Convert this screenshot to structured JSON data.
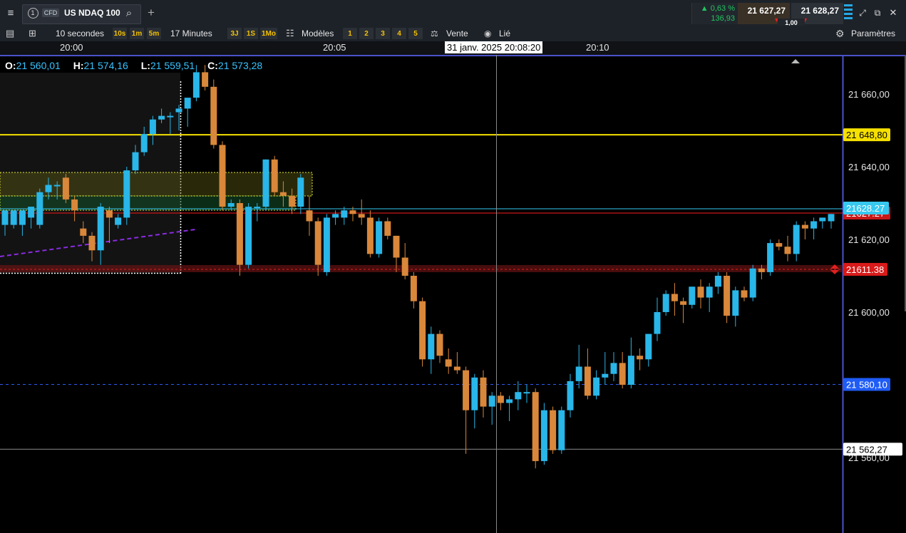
{
  "header": {
    "tab_number": "1",
    "tab_tag": "CFD",
    "instrument": "US NDAQ 100",
    "change_pct": "0,63 %",
    "change_abs": "136,93",
    "sell_price": "21 627,27",
    "buy_price": "21 628,27",
    "spread": "1,00"
  },
  "toolbar": {
    "interval": "10 secondes",
    "quick_intervals": [
      "10s",
      "1m",
      "5m"
    ],
    "range": "17 Minutes",
    "ranges": [
      "3J",
      "1S",
      "1Mo"
    ],
    "templates_label": "Modèles",
    "template_slots": [
      "1",
      "2",
      "3",
      "4",
      "5"
    ],
    "side_label": "Vente",
    "link_label": "Lié",
    "settings_label": "Paramètres"
  },
  "time_axis": {
    "labels": [
      "20:00",
      "20:05",
      "20:10"
    ],
    "crosshair_time": "31 janv. 2025 20:08:20"
  },
  "ohlc": {
    "o_label": "O:",
    "o_value": "21 560,01",
    "h_label": "H:",
    "h_value": "21 574,16",
    "l_label": "L:",
    "l_value": "21 559,51",
    "c_label": "C:",
    "c_value": "21 573,28"
  },
  "price_axis": {
    "ticks": [
      "21 660,00",
      "21 640,00",
      "21 620,00",
      "21 600,00",
      "21 580,00",
      "21 560,00"
    ],
    "tags": {
      "alert": "21 648,80",
      "last": "21628.27",
      "last_hidden": "21627.27",
      "red_level": "21611.38",
      "order": "21 580,10",
      "crosshair": "21 562,27"
    }
  },
  "colors": {
    "up": "#29b6e8",
    "down": "#d9873a",
    "alert_line": "#f5e000",
    "red_line": "#d01a1a",
    "order_line": "#2a5cf0",
    "axis_border": "#4b52c9",
    "change_positive": "#22c55e"
  },
  "chart_data": {
    "type": "candlestick",
    "interval": "10 secondes",
    "ylim": [
      21550,
      21670
    ],
    "x_labels": [
      "20:00",
      "20:05",
      "20:10"
    ],
    "candles": [
      {
        "o": 21624,
        "h": 21628,
        "l": 21621,
        "c": 21628
      },
      {
        "o": 21624,
        "h": 21628,
        "l": 21623,
        "c": 21628
      },
      {
        "o": 21624,
        "h": 21627,
        "l": 21621,
        "c": 21628
      },
      {
        "o": 21626,
        "h": 21628,
        "l": 21623,
        "c": 21629
      },
      {
        "o": 21624,
        "h": 21634,
        "l": 21623,
        "c": 21633
      },
      {
        "o": 21633,
        "h": 21637,
        "l": 21631,
        "c": 21635
      },
      {
        "o": 21635,
        "h": 21636,
        "l": 21631,
        "c": 21635
      },
      {
        "o": 21637,
        "h": 21638,
        "l": 21630,
        "c": 21631
      },
      {
        "o": 21631,
        "h": 21632,
        "l": 21625,
        "c": 21628
      },
      {
        "o": 21623,
        "h": 21625,
        "l": 21619,
        "c": 21621
      },
      {
        "o": 21621,
        "h": 21622,
        "l": 21614,
        "c": 21617
      },
      {
        "o": 21617,
        "h": 21630,
        "l": 21613,
        "c": 21629
      },
      {
        "o": 21628,
        "h": 21629,
        "l": 21619,
        "c": 21626
      },
      {
        "o": 21624,
        "h": 21627,
        "l": 21623,
        "c": 21626
      },
      {
        "o": 21626,
        "h": 21640,
        "l": 21624,
        "c": 21639
      },
      {
        "o": 21639,
        "h": 21646,
        "l": 21638,
        "c": 21644
      },
      {
        "o": 21644,
        "h": 21651,
        "l": 21643,
        "c": 21649
      },
      {
        "o": 21649,
        "h": 21654,
        "l": 21646,
        "c": 21653
      },
      {
        "o": 21653,
        "h": 21656,
        "l": 21652,
        "c": 21654
      },
      {
        "o": 21654,
        "h": 21655,
        "l": 21649,
        "c": 21654
      },
      {
        "o": 21655,
        "h": 21657,
        "l": 21650,
        "c": 21656
      },
      {
        "o": 21656,
        "h": 21659,
        "l": 21651,
        "c": 21659
      },
      {
        "o": 21659,
        "h": 21668,
        "l": 21658,
        "c": 21666
      },
      {
        "o": 21666,
        "h": 21668,
        "l": 21661,
        "c": 21662
      },
      {
        "o": 21662,
        "h": 21664,
        "l": 21645,
        "c": 21646
      },
      {
        "o": 21646,
        "h": 21647,
        "l": 21628,
        "c": 21629
      },
      {
        "o": 21629,
        "h": 21631,
        "l": 21628,
        "c": 21630
      },
      {
        "o": 21630,
        "h": 21631,
        "l": 21610,
        "c": 21613
      },
      {
        "o": 21613,
        "h": 21630,
        "l": 21612,
        "c": 21629
      },
      {
        "o": 21629,
        "h": 21630,
        "l": 21625,
        "c": 21629
      },
      {
        "o": 21629,
        "h": 21642,
        "l": 21628,
        "c": 21642
      },
      {
        "o": 21642,
        "h": 21643,
        "l": 21632,
        "c": 21633
      },
      {
        "o": 21633,
        "h": 21636,
        "l": 21629,
        "c": 21632
      },
      {
        "o": 21632,
        "h": 21634,
        "l": 21627,
        "c": 21629
      },
      {
        "o": 21629,
        "h": 21638,
        "l": 21627,
        "c": 21637
      },
      {
        "o": 21628,
        "h": 21632,
        "l": 21621,
        "c": 21625
      },
      {
        "o": 21625,
        "h": 21626,
        "l": 21610,
        "c": 21613
      },
      {
        "o": 21611,
        "h": 21627,
        "l": 21610,
        "c": 21626
      },
      {
        "o": 21626,
        "h": 21628,
        "l": 21624,
        "c": 21627
      },
      {
        "o": 21626,
        "h": 21629,
        "l": 21624,
        "c": 21628
      },
      {
        "o": 21628,
        "h": 21629,
        "l": 21625,
        "c": 21627
      },
      {
        "o": 21627,
        "h": 21631,
        "l": 21624,
        "c": 21626
      },
      {
        "o": 21626,
        "h": 21628,
        "l": 21615,
        "c": 21616
      },
      {
        "o": 21616,
        "h": 21626,
        "l": 21615,
        "c": 21625
      },
      {
        "o": 21625,
        "h": 21626,
        "l": 21620,
        "c": 21621
      },
      {
        "o": 21621,
        "h": 21621,
        "l": 21611,
        "c": 21615
      },
      {
        "o": 21615,
        "h": 21619,
        "l": 21609,
        "c": 21610
      },
      {
        "o": 21610,
        "h": 21611,
        "l": 21601,
        "c": 21603
      },
      {
        "o": 21603,
        "h": 21604,
        "l": 21585,
        "c": 21587
      },
      {
        "o": 21587,
        "h": 21596,
        "l": 21583,
        "c": 21594
      },
      {
        "o": 21594,
        "h": 21595,
        "l": 21586,
        "c": 21588
      },
      {
        "o": 21587,
        "h": 21590,
        "l": 21583,
        "c": 21585
      },
      {
        "o": 21585,
        "h": 21589,
        "l": 21583,
        "c": 21584
      },
      {
        "o": 21584,
        "h": 21585,
        "l": 21561,
        "c": 21573
      },
      {
        "o": 21573,
        "h": 21583,
        "l": 21568,
        "c": 21582
      },
      {
        "o": 21582,
        "h": 21584,
        "l": 21571,
        "c": 21574
      },
      {
        "o": 21574,
        "h": 21578,
        "l": 21569,
        "c": 21577
      },
      {
        "o": 21577,
        "h": 21578,
        "l": 21573,
        "c": 21575
      },
      {
        "o": 21575,
        "h": 21577,
        "l": 21570,
        "c": 21576
      },
      {
        "o": 21576,
        "h": 21581,
        "l": 21573,
        "c": 21578
      },
      {
        "o": 21578,
        "h": 21580,
        "l": 21575,
        "c": 21578
      },
      {
        "o": 21578,
        "h": 21579,
        "l": 21557,
        "c": 21559
      },
      {
        "o": 21559,
        "h": 21575,
        "l": 21558,
        "c": 21573
      },
      {
        "o": 21573,
        "h": 21574,
        "l": 21561,
        "c": 21562
      },
      {
        "o": 21562,
        "h": 21574,
        "l": 21561,
        "c": 21573
      },
      {
        "o": 21573,
        "h": 21583,
        "l": 21571,
        "c": 21581
      },
      {
        "o": 21581,
        "h": 21591,
        "l": 21579,
        "c": 21585
      },
      {
        "o": 21585,
        "h": 21590,
        "l": 21576,
        "c": 21577
      },
      {
        "o": 21577,
        "h": 21584,
        "l": 21576,
        "c": 21582
      },
      {
        "o": 21582,
        "h": 21589,
        "l": 21580,
        "c": 21583
      },
      {
        "o": 21583,
        "h": 21589,
        "l": 21581,
        "c": 21586
      },
      {
        "o": 21586,
        "h": 21589,
        "l": 21579,
        "c": 21580
      },
      {
        "o": 21580,
        "h": 21593,
        "l": 21579,
        "c": 21588
      },
      {
        "o": 21588,
        "h": 21590,
        "l": 21584,
        "c": 21587
      },
      {
        "o": 21587,
        "h": 21594,
        "l": 21585,
        "c": 21594
      },
      {
        "o": 21594,
        "h": 21604,
        "l": 21592,
        "c": 21600
      },
      {
        "o": 21600,
        "h": 21606,
        "l": 21599,
        "c": 21605
      },
      {
        "o": 21605,
        "h": 21608,
        "l": 21599,
        "c": 21603
      },
      {
        "o": 21603,
        "h": 21604,
        "l": 21597,
        "c": 21602
      },
      {
        "o": 21602,
        "h": 21607,
        "l": 21601,
        "c": 21607
      },
      {
        "o": 21607,
        "h": 21609,
        "l": 21601,
        "c": 21604
      },
      {
        "o": 21604,
        "h": 21608,
        "l": 21600,
        "c": 21607
      },
      {
        "o": 21607,
        "h": 21611,
        "l": 21605,
        "c": 21610
      },
      {
        "o": 21610,
        "h": 21611,
        "l": 21597,
        "c": 21599
      },
      {
        "o": 21599,
        "h": 21607,
        "l": 21596,
        "c": 21606
      },
      {
        "o": 21606,
        "h": 21607,
        "l": 21603,
        "c": 21604
      },
      {
        "o": 21604,
        "h": 21613,
        "l": 21603,
        "c": 21612
      },
      {
        "o": 21612,
        "h": 21613,
        "l": 21609,
        "c": 21611
      },
      {
        "o": 21611,
        "h": 21620,
        "l": 21610,
        "c": 21619
      },
      {
        "o": 21619,
        "h": 21620,
        "l": 21617,
        "c": 21618
      },
      {
        "o": 21618,
        "h": 21621,
        "l": 21614,
        "c": 21616
      },
      {
        "o": 21616,
        "h": 21625,
        "l": 21614,
        "c": 21624
      },
      {
        "o": 21624,
        "h": 21625,
        "l": 21620,
        "c": 21623
      },
      {
        "o": 21623,
        "h": 21626,
        "l": 21620,
        "c": 21625
      },
      {
        "o": 21625,
        "h": 21626,
        "l": 21623,
        "c": 21626
      },
      {
        "o": 21625,
        "h": 21627,
        "l": 21623,
        "c": 21627
      }
    ]
  }
}
